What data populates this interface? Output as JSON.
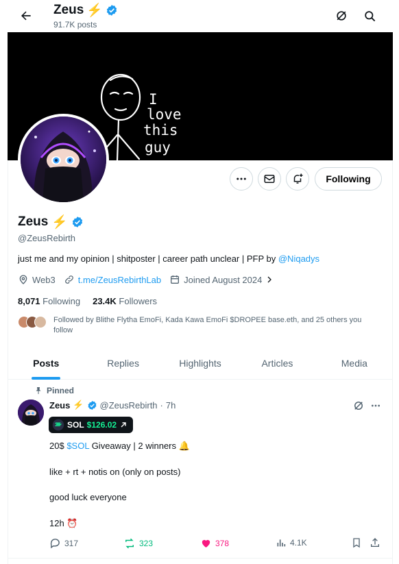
{
  "header": {
    "name": "Zeus",
    "name_emoji": "⚡",
    "posts_count": "91.7K posts"
  },
  "banner": {
    "caption_lines": [
      "I",
      "love",
      "this",
      "guy"
    ]
  },
  "profile": {
    "follow_label": "Following",
    "name": "Zeus",
    "name_emoji": "⚡",
    "handle": "@ZeusRebirth",
    "bio_text": "just me and my opinion | shitposter | career path unclear | PFP by ",
    "bio_mention": "@Niqadys",
    "location": "Web3",
    "website": "t.me/ZeusRebirthLab",
    "joined": "Joined August 2024",
    "following_count": "8,071",
    "following_label": "Following",
    "followers_count": "23.4K",
    "followers_label": "Followers",
    "followed_by": "Followed by Blithe Flytha EmoFi, Kada Kawa EmoFi $DROPEE base.eth, and 25 others you follow"
  },
  "tabs": [
    {
      "label": "Posts",
      "active": true
    },
    {
      "label": "Replies",
      "active": false
    },
    {
      "label": "Highlights",
      "active": false
    },
    {
      "label": "Articles",
      "active": false
    },
    {
      "label": "Media",
      "active": false
    }
  ],
  "tweet": {
    "pinned_label": "Pinned",
    "author_name": "Zeus",
    "author_emoji": "⚡",
    "author_handle": "@ZeusRebirth",
    "separator": "·",
    "time": "7h",
    "chip_token": "SOL",
    "chip_price": "$126.02",
    "line1_prefix": "20$ ",
    "line1_cashtag": "$SOL",
    "line1_suffix": " Giveaway | 2 winners 🔔",
    "line2": "like + rt + notis on (only on posts)",
    "line3": "good luck everyone",
    "line4": "12h ⏰",
    "replies": "317",
    "reposts": "323",
    "likes": "378",
    "views": "4.1K"
  },
  "colors": {
    "accent": "#1d9bf0",
    "repost": "#00ba7c",
    "like": "#f91880",
    "sol_green": "#14f195"
  },
  "icons": [
    "back-arrow-icon",
    "grok-icon",
    "search-icon",
    "more-icon",
    "message-icon",
    "notification-add-icon",
    "verified-icon",
    "location-icon",
    "link-icon",
    "calendar-icon",
    "pin-icon",
    "reply-icon",
    "repost-icon",
    "like-icon",
    "views-icon",
    "bookmark-icon",
    "share-icon"
  ]
}
